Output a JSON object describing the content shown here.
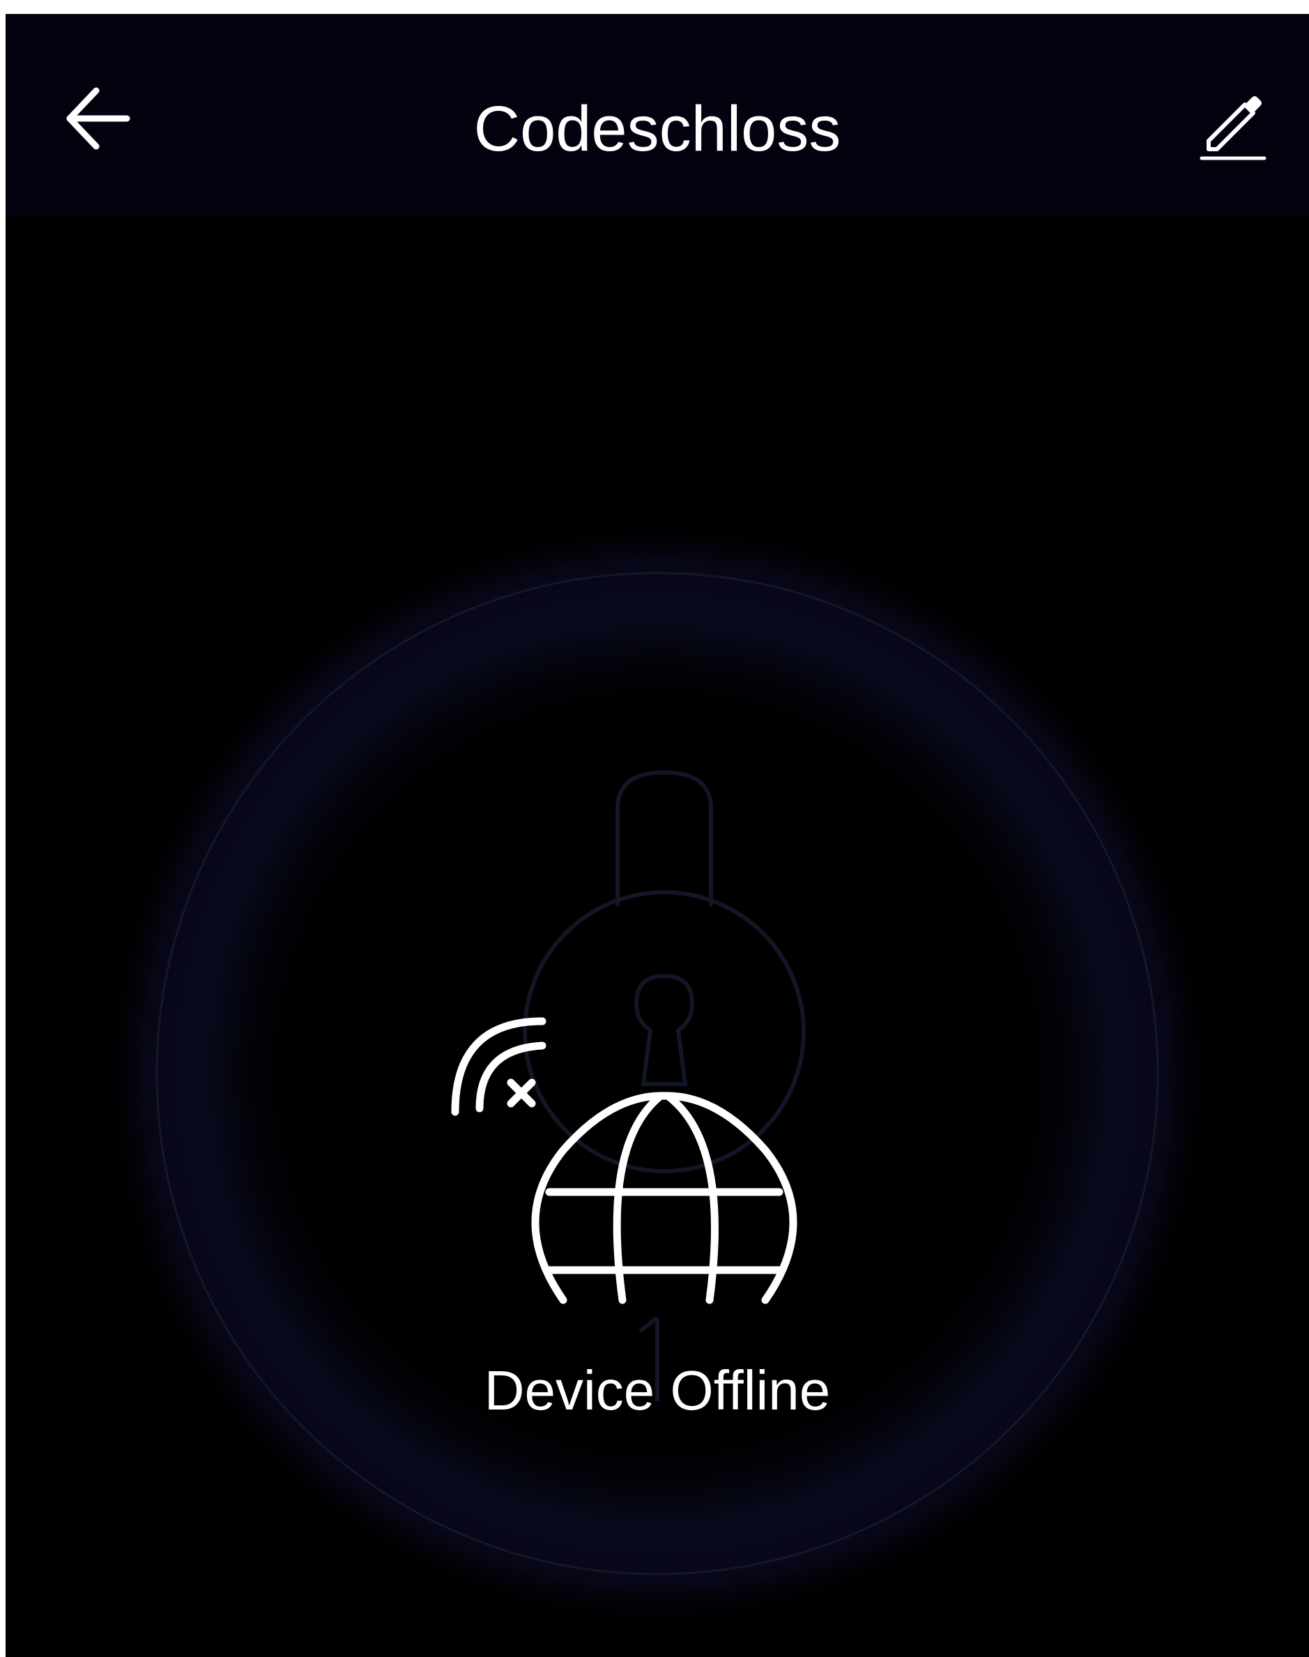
{
  "header": {
    "title": "Codeschloss",
    "back_icon": "arrow-left-icon",
    "edit_icon": "pencil-edit-icon"
  },
  "main": {
    "status": "Device Offline",
    "status_icon": "globe-offline-icon",
    "background_icon": "padlock-icon"
  },
  "colors": {
    "header_bg": "#02030f",
    "screen_bg": "#000000",
    "text": "#ffffff",
    "ring_glow": "#0b0d2a"
  }
}
